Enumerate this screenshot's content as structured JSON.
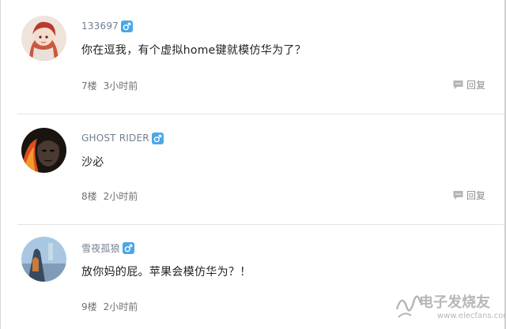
{
  "comments": [
    {
      "username": "133697",
      "gender": "male",
      "content": "你在逗我，有个虚拟home键就模仿华为了？",
      "floor": "7楼",
      "time": "3小时前",
      "reply_label": "回复"
    },
    {
      "username": "GHOST RIDER",
      "gender": "male",
      "content": "沙必",
      "floor": "8楼",
      "time": "2小时前",
      "reply_label": "回复"
    },
    {
      "username": "雪夜孤狼",
      "gender": "male",
      "content": "放你妈的屁。苹果会模仿华为？！",
      "floor": "9楼",
      "time": "2小时前"
    }
  ],
  "icons": {
    "gender": "male-symbol-icon",
    "reply": "speech-bubble-icon"
  },
  "colors": {
    "gender_badge": "#4aa6e8",
    "username": "#6f7f8f"
  },
  "watermark": {
    "brand": "电子发烧友",
    "url": "www.elecfans.com"
  }
}
